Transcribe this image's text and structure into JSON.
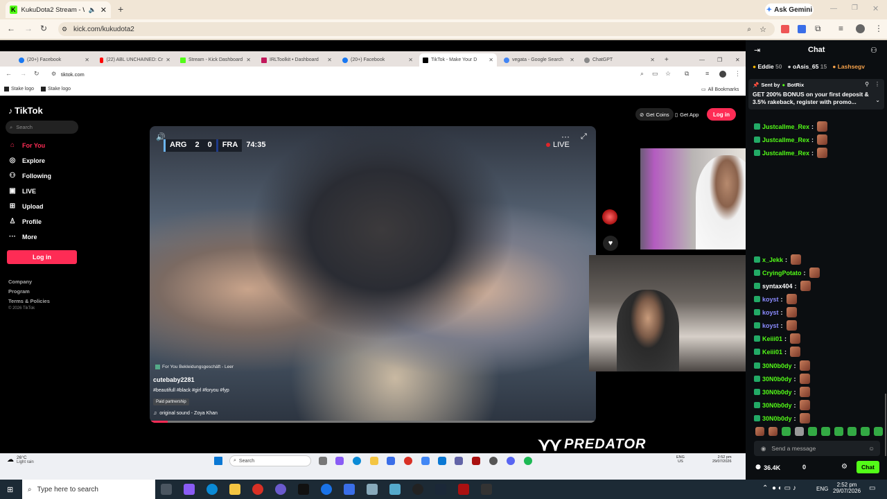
{
  "outer_browser": {
    "tab_title": "KukuDota2 Stream - Watch",
    "url": "kick.com/kukudota2",
    "ask_gemini": "Ask Gemini"
  },
  "inner_browser": {
    "tabs": [
      {
        "title": "(20+) Facebook",
        "color": "#1877f2"
      },
      {
        "title": "(22) ABL UNCHAINED: Cr",
        "color": "#ff0000"
      },
      {
        "title": "Stream - Kick Dashboard",
        "color": "#53fc18"
      },
      {
        "title": "IRLToolkit • Dashboard",
        "color": "#c2185b"
      },
      {
        "title": "(20+) Facebook",
        "color": "#1877f2"
      },
      {
        "title": "TikTok - Make Your D",
        "color": "#000000"
      },
      {
        "title": "vegata - Google Search",
        "color": "#4285f4"
      },
      {
        "title": "ChatGPT",
        "color": "#888888"
      }
    ],
    "url": "tiktok.com",
    "bookmarks": [
      "Stake logo",
      "Stake logo"
    ],
    "all_bookmarks": "All Bookmarks"
  },
  "tiktok": {
    "logo": "TikTok",
    "search_placeholder": "Search",
    "nav": [
      "For You",
      "Explore",
      "Following",
      "LIVE",
      "Upload",
      "Profile",
      "More"
    ],
    "login": "Log in",
    "footer": [
      "Company",
      "Program",
      "Terms & Policies",
      "© 2026 TikTok"
    ],
    "get_coins": "Get Coins",
    "get_app": "Get App",
    "header_login": "Log in",
    "video": {
      "scoreboard": {
        "team1": "ARG",
        "score1": "2",
        "score2": "0",
        "team2": "FRA",
        "time": "74:35"
      },
      "live": "LIVE",
      "promo": "For You Bekleidungsgeschäft - Leer",
      "username": "cutebaby2281",
      "hashtags": "#beautifull #black #girl #foryou #fyp",
      "partnership": "Paid partnership",
      "sound": "original sound - Zoya Khan"
    }
  },
  "chat": {
    "title": "Chat",
    "top_users": [
      {
        "name": "Eddie",
        "count": "50"
      },
      {
        "name": "oAsis_65",
        "count": "15"
      },
      {
        "name": "Lashsegv",
        "count": ""
      }
    ],
    "pinned": {
      "sent_by": "Sent by",
      "sender": "BotRix",
      "text": "GET 200% BONUS on your first deposit & 3.5% rakeback, register with promo..."
    },
    "messages": [
      {
        "user": "Justcallme_Rex",
        "color": "#53fc18"
      },
      {
        "user": "Justcallme_Rex",
        "color": "#53fc18"
      },
      {
        "user": "Justcallme_Rex",
        "color": "#53fc18"
      },
      {
        "user": "x_Jekk",
        "color": "#53fc18"
      },
      {
        "user": "CryingPotato",
        "color": "#53fc18"
      },
      {
        "user": "syntax404",
        "color": "#ffffff"
      },
      {
        "user": "koyst",
        "color": "#8b8bff"
      },
      {
        "user": "koyst",
        "color": "#8b8bff"
      },
      {
        "user": "koyst",
        "color": "#8b8bff"
      },
      {
        "user": "Keiii01",
        "color": "#53fc18"
      },
      {
        "user": "Keiii01",
        "color": "#53fc18"
      },
      {
        "user": "30N0b0dy",
        "color": "#53fc18"
      },
      {
        "user": "30N0b0dy",
        "color": "#53fc18"
      },
      {
        "user": "30N0b0dy",
        "color": "#53fc18"
      },
      {
        "user": "30N0b0dy",
        "color": "#53fc18"
      },
      {
        "user": "30N0b0dy",
        "color": "#53fc18"
      }
    ],
    "input_placeholder": "Send a message",
    "viewers": "36.4K",
    "count": "0",
    "chat_button": "Chat"
  },
  "inner_taskbar": {
    "weather_temp": "26°C",
    "weather_desc": "Light rain",
    "search": "Search",
    "lang1": "ENG",
    "lang2": "US",
    "time": "2:52 pm",
    "date": "29/07/2026"
  },
  "win_taskbar": {
    "search_placeholder": "Type here to search",
    "lang": "ENG",
    "time": "2:52 pm",
    "date": "29/07/2026"
  },
  "watermark": "PREDATOR"
}
